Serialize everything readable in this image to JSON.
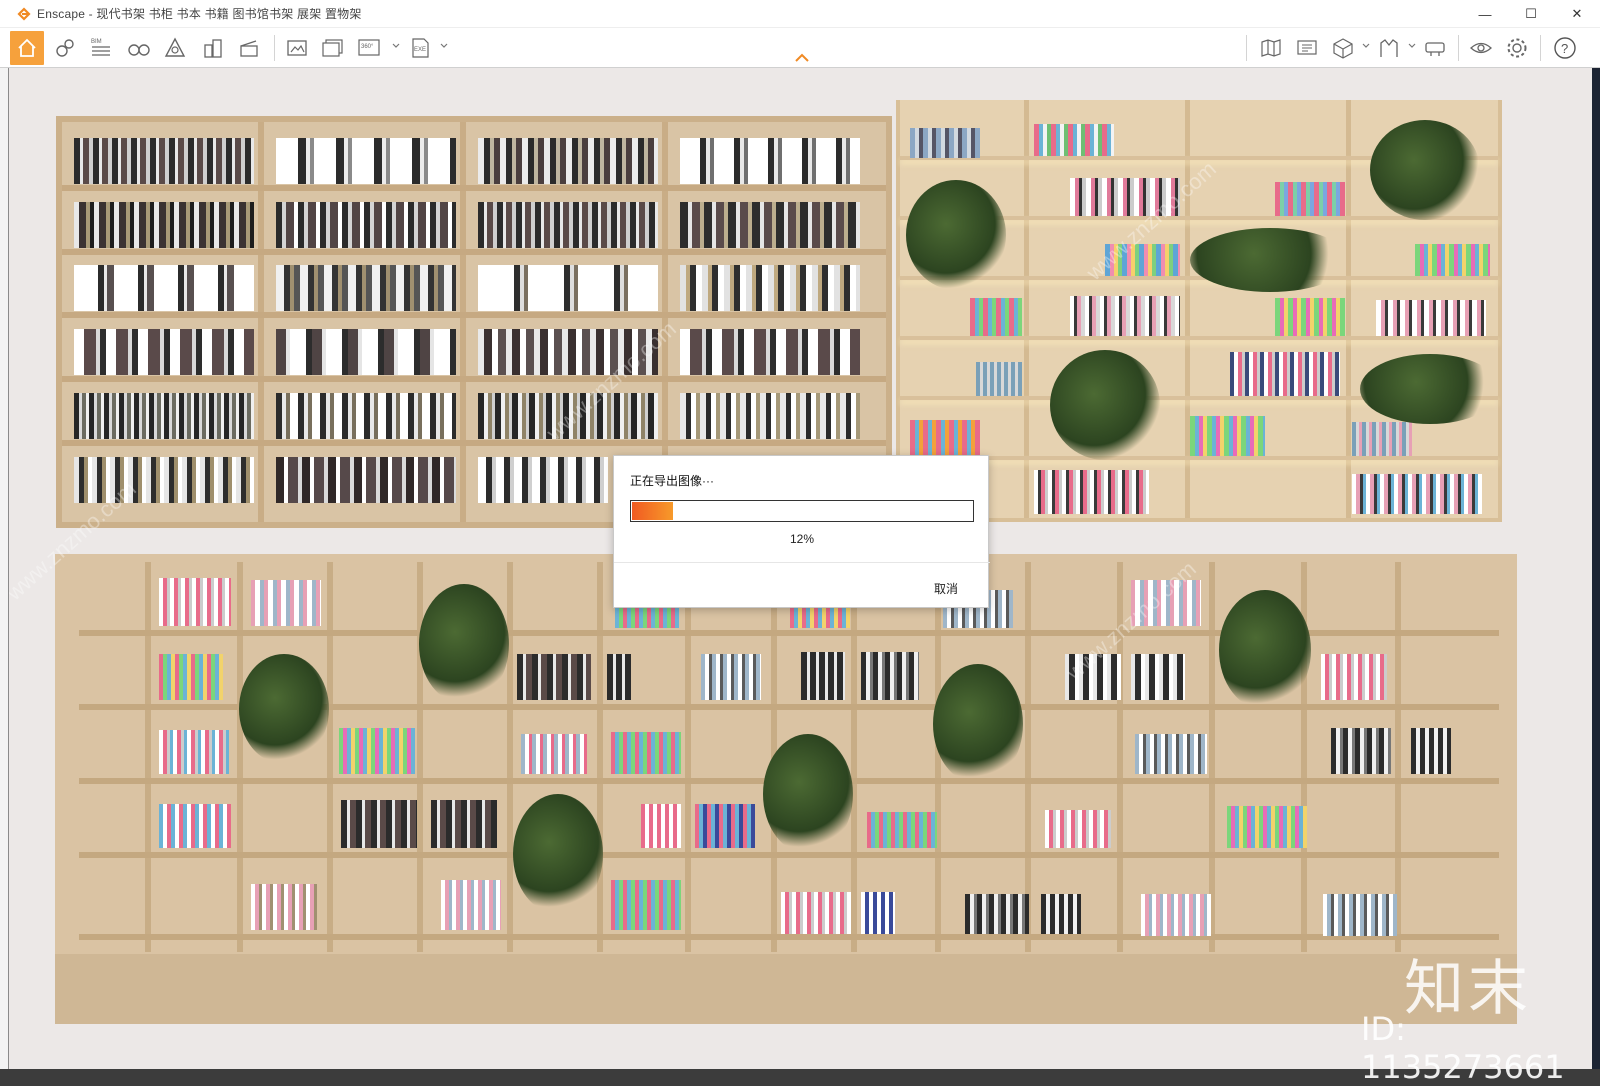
{
  "window": {
    "title": "Enscape - 现代书架 书柜 书本 书籍 图书馆书架 展架 置物架",
    "controls": {
      "minimize": "—",
      "maximize": "☐",
      "close": "✕"
    }
  },
  "toolbar": {
    "left_icons": [
      "home-icon",
      "asset-library-icon",
      "bim-icon",
      "binoculars-icon",
      "visual-settings-icon",
      "buildings-icon",
      "clapper-icon",
      "screenshot-icon",
      "batch-render-icon",
      "panorama-360-icon",
      "exe-export-icon"
    ],
    "bim_label": "BIM",
    "panorama_label": "360°",
    "exe_label": "EXE",
    "right_icons": [
      "map-icon",
      "upload-icon",
      "cube-icon",
      "vr-icon",
      "headset-icon",
      "visibility-icon",
      "settings-icon",
      "help-icon"
    ],
    "help_label": "?"
  },
  "dialog": {
    "title": "正在导出图像···",
    "progress": 0.12,
    "progress_text": "12%",
    "cancel_label": "取消"
  },
  "watermark": {
    "brand": "知末",
    "id_text": "ID: 1135273661",
    "site_text": "www.znzmo.com"
  },
  "colors": {
    "accent": "#f6a13c",
    "progress_start": "#f05a22",
    "progress_end": "#f79a2a",
    "viewport_bg": "#ece8e7"
  }
}
